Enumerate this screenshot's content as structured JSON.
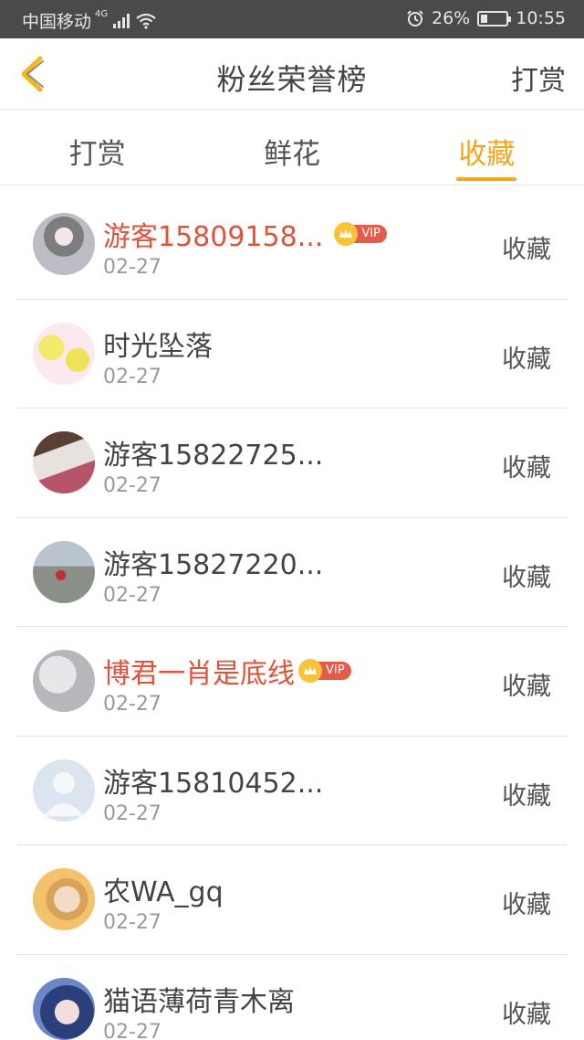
{
  "status_bar": {
    "carrier": "中国移动",
    "network": "4G",
    "battery": "26%",
    "battery_level": 0.26,
    "time": "10:55"
  },
  "header": {
    "title": "粉丝荣誉榜",
    "action_label": "打赏"
  },
  "tabs": [
    {
      "label": "打赏",
      "active": false
    },
    {
      "label": "鲜花",
      "active": false
    },
    {
      "label": "收藏",
      "active": true
    }
  ],
  "list": [
    {
      "name": "游客15809158...",
      "date": "02-27",
      "action": "收藏",
      "vip": true,
      "vip_label": "VIP"
    },
    {
      "name": "时光坠落",
      "date": "02-27",
      "action": "收藏",
      "vip": false
    },
    {
      "name": "游客15822725...",
      "date": "02-27",
      "action": "收藏",
      "vip": false
    },
    {
      "name": "游客15827220...",
      "date": "02-27",
      "action": "收藏",
      "vip": false
    },
    {
      "name": "博君一肖是底线",
      "date": "02-27",
      "action": "收藏",
      "vip": true,
      "vip_label": "VIP"
    },
    {
      "name": "游客15810452...",
      "date": "02-27",
      "action": "收藏",
      "vip": false
    },
    {
      "name": "农WA_gq",
      "date": "02-27",
      "action": "收藏",
      "vip": false
    },
    {
      "name": "猫语薄荷青木离",
      "date": "02-27",
      "action": "收藏",
      "vip": false
    }
  ],
  "colors": {
    "accent": "#f4a51c",
    "vip_name": "#e0533a",
    "status_bar_bg": "#4a4a4a"
  }
}
